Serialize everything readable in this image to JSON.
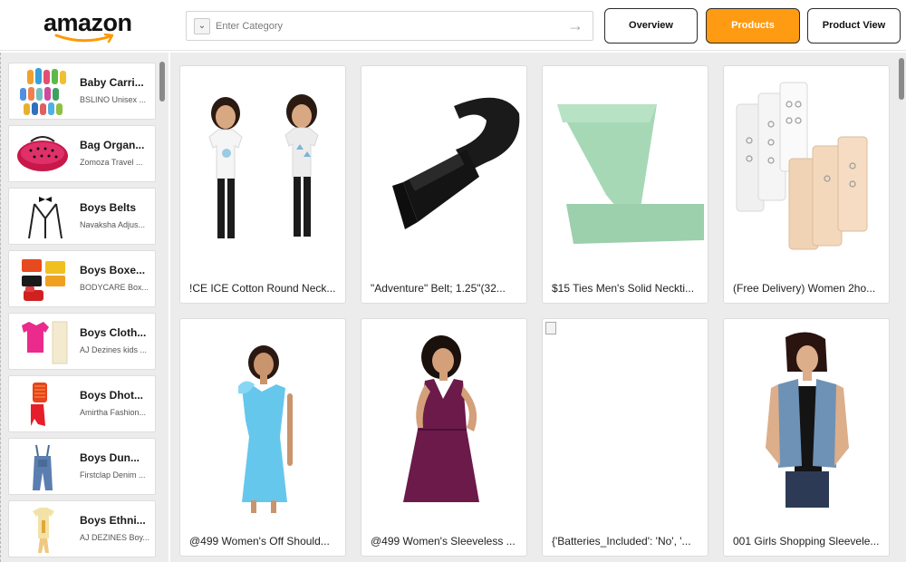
{
  "header": {
    "logo_text": "amazon",
    "category_placeholder": "Enter Category",
    "nav": {
      "overview": "Overview",
      "products": "Products",
      "product_view": "Product View"
    },
    "active_tab": "Products",
    "accent_color": "#ff9b12"
  },
  "sidebar": {
    "items": [
      {
        "title": "Baby Carri...",
        "subtitle": "BSLINO Unisex ...",
        "icon": "socks-thumbnail"
      },
      {
        "title": "Bag Organ...",
        "subtitle": "Zomoza Travel ...",
        "icon": "bag-thumbnail"
      },
      {
        "title": "Boys Belts",
        "subtitle": "Navaksha Adjus...",
        "icon": "suspenders-thumbnail"
      },
      {
        "title": "Boys Boxe...",
        "subtitle": "BODYCARE Box...",
        "icon": "boxers-thumbnail"
      },
      {
        "title": "Boys Cloth...",
        "subtitle": "AJ Dezines kids ...",
        "icon": "shirt-thumbnail"
      },
      {
        "title": "Boys Dhot...",
        "subtitle": "Amirtha Fashion...",
        "icon": "dhoti-thumbnail"
      },
      {
        "title": "Boys Dun...",
        "subtitle": "Firstclap Denim ...",
        "icon": "dungaree-thumbnail"
      },
      {
        "title": "Boys Ethni...",
        "subtitle": "AJ DEZINES Boy...",
        "icon": "ethnic-thumbnail"
      }
    ]
  },
  "products": [
    {
      "caption": "!CE ICE Cotton Round Neck...",
      "icon": "kids-tshirt-image"
    },
    {
      "caption": "\"Adventure\" Belt; 1.25\"(32...",
      "icon": "belt-image"
    },
    {
      "caption": "$15 Ties Men's Solid Neckti...",
      "icon": "necktie-image"
    },
    {
      "caption": "(Free Delivery) Women 2ho...",
      "icon": "bra-extender-image"
    },
    {
      "caption": "@499 Women's Off Should...",
      "icon": "blue-dress-image"
    },
    {
      "caption": "@499 Women's Sleeveless ...",
      "icon": "purple-dress-image"
    },
    {
      "caption": "{'Batteries_Included': 'No', '...",
      "icon": "broken-image"
    },
    {
      "caption": "001 Girls Shopping Sleevele...",
      "icon": "denim-vest-image"
    }
  ]
}
